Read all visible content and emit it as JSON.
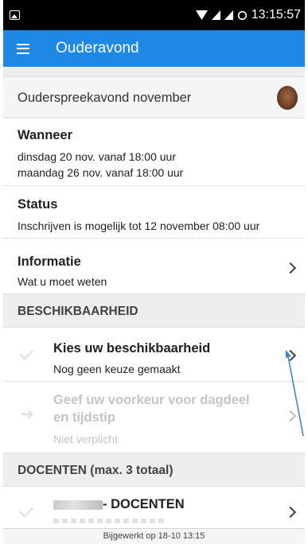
{
  "status_bar": {
    "time": "13:15:57",
    "icons": [
      "image-icon",
      "wifi-icon",
      "signal-icon",
      "signal-icon",
      "sync-icon"
    ]
  },
  "app_bar": {
    "title": "Ouderavond",
    "menu_icon": "hamburger-menu-icon"
  },
  "event": {
    "title": "Ouderspreekavond november",
    "when": {
      "heading": "Wanneer",
      "lines": [
        "dinsdag 20 nov. vanaf 18:00 uur",
        "maandag 26 nov. vanaf 18:00 uur"
      ]
    },
    "status": {
      "heading": "Status",
      "text": "Inschrijven is mogelijk tot 12 november 08:00 uur"
    },
    "info": {
      "heading": "Informatie",
      "text": "Wat u moet weten"
    }
  },
  "availability": {
    "section_title": "BESCHIKBAARHEID",
    "choose": {
      "heading": "Kies uw beschikbaarheid",
      "text": "Nog geen keuze gemaakt"
    },
    "preference": {
      "heading_line1": "Geef uw voorkeur voor dagdeel",
      "heading_line2": "en tijdstip",
      "text": "Niet verplicht"
    }
  },
  "teachers": {
    "section_title": "DOCENTEN (max. 3 totaal)",
    "item_label": "- DOCENTEN"
  },
  "footer": {
    "text": "Bijgewerkt op 18-10 13:15"
  },
  "colors": {
    "app_bar": "#1e88e5",
    "status_bar": "#000000",
    "section_band": "#eeeeee",
    "annotation_arrow": "#3d86c6"
  }
}
